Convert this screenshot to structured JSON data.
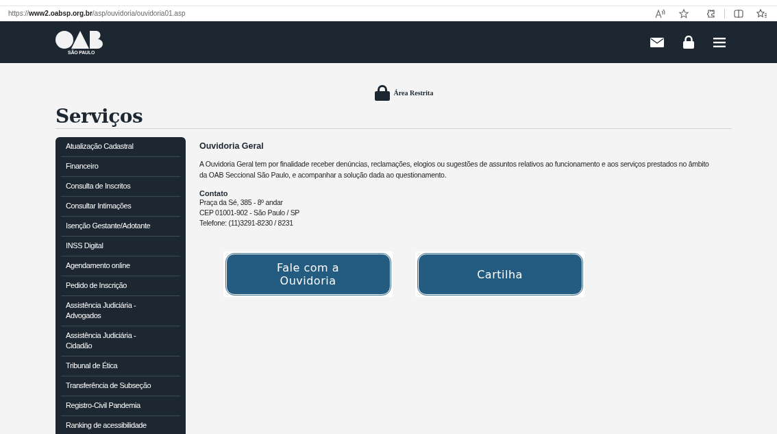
{
  "browser": {
    "url": "https://**www2.oabsp.org.br**/asp/ouvidoria/ouvidoria01.asp"
  },
  "header": {
    "logo_subtitle": "SÃO PAULO"
  },
  "restricted_area": {
    "label": "Área Restrita"
  },
  "page_title": "Serviços",
  "sidebar": {
    "items": [
      {
        "label": "Atualização Cadastral"
      },
      {
        "label": "Financeiro"
      },
      {
        "label": "Consulta de Inscritos"
      },
      {
        "label": "Consultar Intimações"
      },
      {
        "label": "Isenção Gestante/Adotante"
      },
      {
        "label": "INSS Digital"
      },
      {
        "label": "Agendamento online"
      },
      {
        "label": "Pedido de Inscrição"
      },
      {
        "label": "Assistência Judiciária - Advogados"
      },
      {
        "label": "Assistência Judiciária - Cidadão"
      },
      {
        "label": "Tribunal de Ética"
      },
      {
        "label": "Transferência de Subseção"
      },
      {
        "label": "Registro-Civil Pandemia"
      },
      {
        "label": "Ranking de acessibilidade"
      }
    ]
  },
  "content": {
    "title": "Ouvidoria Geral",
    "description": "A Ouvidoria Geral tem por finalidade receber denúncias, reclamações, elogios ou sugestões de assuntos relativos ao funcionamento e aos serviços prestados no âmbito da OAB Seccional São Paulo, e acompanhar a solução dada ao questionamento.",
    "contact_heading": "Contato",
    "contact_lines": [
      "Praça da Sé, 385 - 8º andar",
      "CEP 01001-902 - São Paulo / SP",
      "Telefone: (11)3291-8230 / 8231"
    ],
    "buttons": [
      {
        "label": "Fale com a Ouvidoria"
      },
      {
        "label": "Cartilha"
      }
    ]
  }
}
